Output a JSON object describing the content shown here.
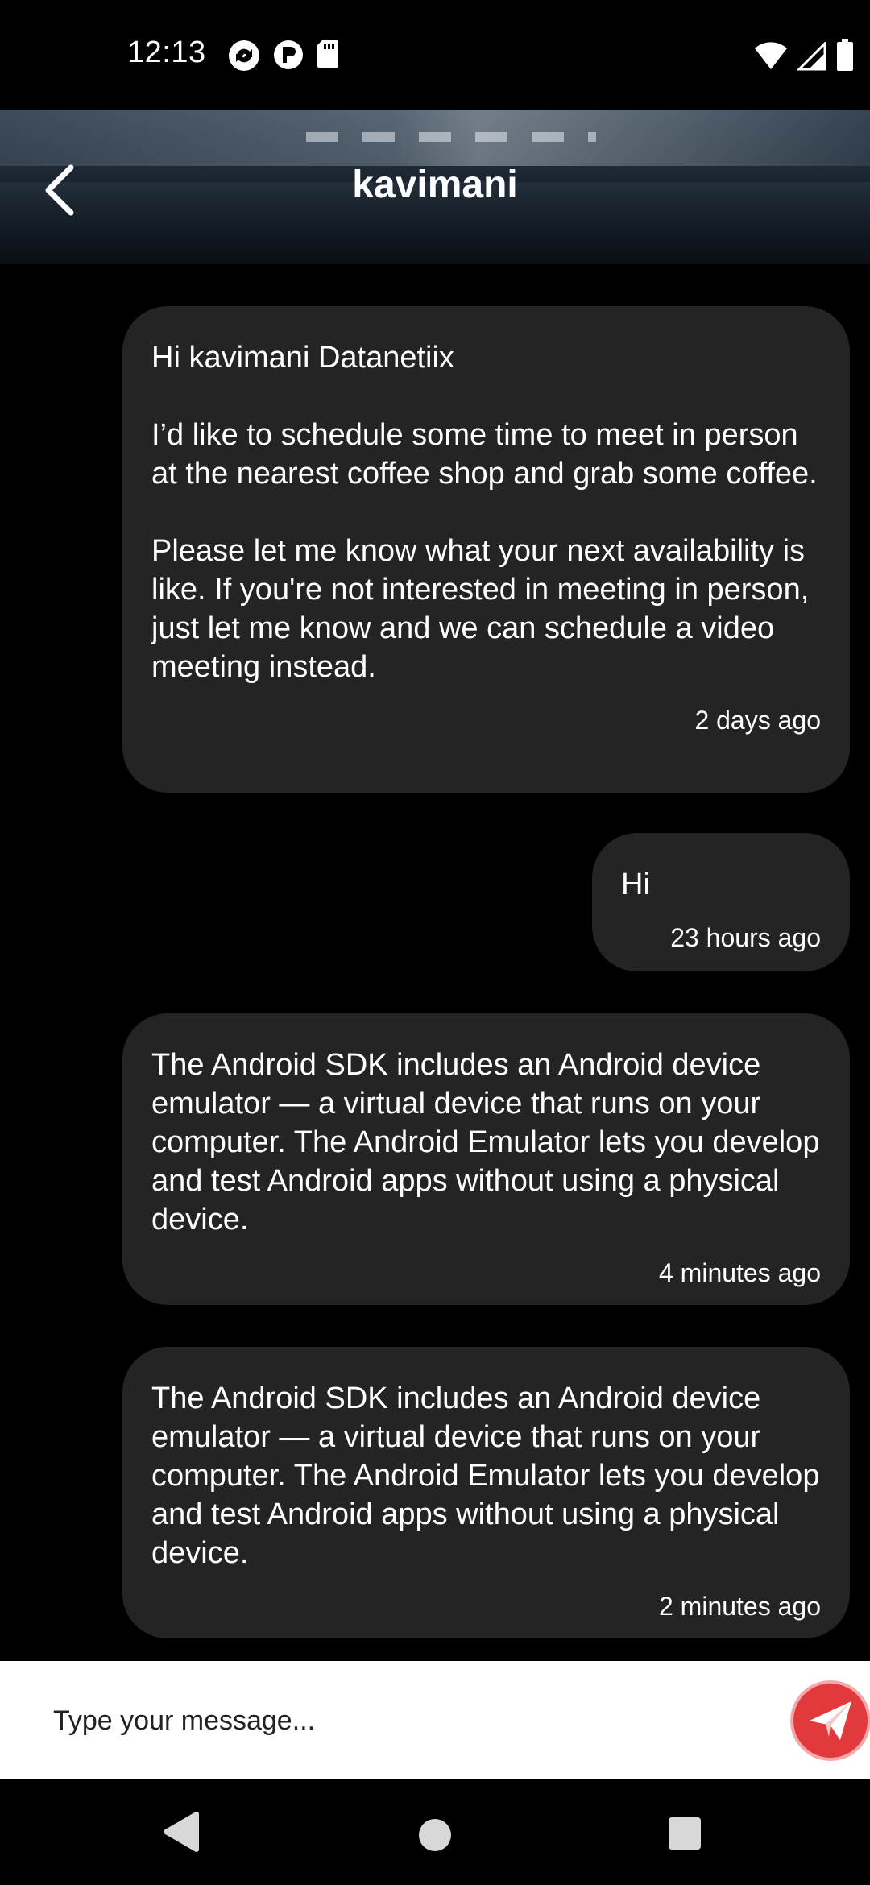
{
  "status_bar": {
    "time": "12:13",
    "left_icons": [
      "sync-icon",
      "p-badge-icon",
      "sd-card-icon"
    ],
    "right_icons": [
      "wifi-icon",
      "signal-icon",
      "battery-icon"
    ]
  },
  "header": {
    "title": "kavimani",
    "back_icon": "chevron-left-icon"
  },
  "messages": [
    {
      "text": "Hi kavimani Datanetiix\n\nI’d like to schedule some time to meet in person at the nearest coffee shop and grab some coffee.\n\nPlease let me know what your next availability is like. If you're not interested in meeting in person, just let me know and we can schedule a video meeting instead.",
      "time": "2 days ago"
    },
    {
      "text": "Hi",
      "time": "23 hours ago"
    },
    {
      "text": "The Android SDK includes an Android device emulator — a virtual device that runs on your computer. The Android Emulator lets you develop and test Android apps without using a physical device.",
      "time": "4 minutes ago"
    },
    {
      "text": "The Android SDK includes an Android device emulator — a virtual device that runs on your computer. The Android Emulator lets you develop and test Android apps without using a physical device.",
      "time": "2 minutes ago"
    }
  ],
  "composer": {
    "placeholder": "Type your message...",
    "send_icon": "paper-plane-icon"
  },
  "colors": {
    "background": "#000000",
    "bubble": "#242424",
    "send_button": "#e2393d",
    "composer_bg": "#ffffff"
  },
  "nav_bar": {
    "icons": [
      "back-triangle-icon",
      "home-circle-icon",
      "recents-square-icon"
    ]
  }
}
